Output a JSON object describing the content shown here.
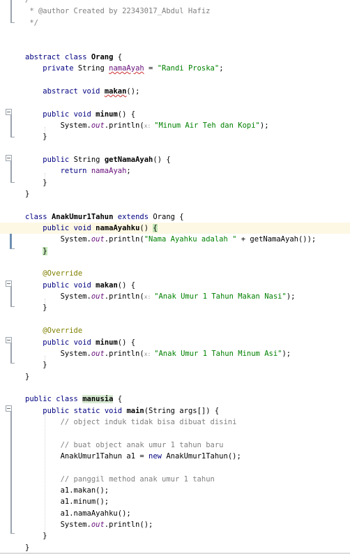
{
  "code_lines": [
    [
      {
        "t": "/**",
        "c": "cm"
      }
    ],
    [
      {
        "t": " * @author Created by 22343017_Abdul Hafiz",
        "c": "cm"
      }
    ],
    [
      {
        "t": " */",
        "c": "cm"
      }
    ],
    [],
    [],
    [
      {
        "t": "abstract ",
        "c": "kw"
      },
      {
        "t": "class ",
        "c": "kw"
      },
      {
        "t": "Orang",
        "c": "bold"
      },
      {
        "t": " {"
      }
    ],
    [
      {
        "t": "    "
      },
      {
        "t": "private ",
        "c": "kw"
      },
      {
        "t": "String "
      },
      {
        "t": "namaAyah",
        "c": "fld uw"
      },
      {
        "t": " = "
      },
      {
        "t": "\"Randi Proska\"",
        "c": "str"
      },
      {
        "t": ";"
      }
    ],
    [],
    [
      {
        "t": "    "
      },
      {
        "t": "abstract ",
        "c": "kw"
      },
      {
        "t": "void ",
        "c": "kw"
      },
      {
        "t": "makan",
        "c": "bold uw"
      },
      {
        "t": "();"
      }
    ],
    [],
    [
      {
        "t": "    "
      },
      {
        "t": "public ",
        "c": "kw"
      },
      {
        "t": "void ",
        "c": "kw"
      },
      {
        "t": "minum",
        "c": "bold"
      },
      {
        "t": "() {"
      }
    ],
    [
      {
        "t": "        System."
      },
      {
        "t": "out",
        "c": "out"
      },
      {
        "t": ".println("
      },
      {
        "t": "x: ",
        "c": "hint"
      },
      {
        "t": "\"Minum Air Teh dan Kopi\"",
        "c": "str"
      },
      {
        "t": ");"
      }
    ],
    [
      {
        "t": "    }"
      }
    ],
    [],
    [
      {
        "t": "    "
      },
      {
        "t": "public ",
        "c": "kw"
      },
      {
        "t": "String "
      },
      {
        "t": "getNamaAyah",
        "c": "bold"
      },
      {
        "t": "() {"
      }
    ],
    [
      {
        "t": "        "
      },
      {
        "t": "return ",
        "c": "kw"
      },
      {
        "t": "namaAyah",
        "c": "fld"
      },
      {
        "t": ";"
      }
    ],
    [
      {
        "t": "    }"
      }
    ],
    [
      {
        "t": "}"
      }
    ],
    [],
    [
      {
        "t": "class ",
        "c": "kw"
      },
      {
        "t": "AnakUmur1Tahun",
        "c": "bold"
      },
      {
        "t": " "
      },
      {
        "t": "extends ",
        "c": "kw"
      },
      {
        "t": "Orang"
      },
      {
        "t": " {"
      }
    ],
    [
      {
        "t": "    "
      },
      {
        "t": "public ",
        "c": "kw"
      },
      {
        "t": "void ",
        "c": "kw"
      },
      {
        "t": "namaAyahku",
        "c": "bold"
      },
      {
        "t": "() "
      },
      {
        "t": "{",
        "c": "hl-brace"
      }
    ],
    [
      {
        "t": "        System."
      },
      {
        "t": "out",
        "c": "out"
      },
      {
        "t": ".println("
      },
      {
        "t": "\"Nama Ayahku adalah \"",
        "c": "str"
      },
      {
        "t": " + getNamaAyah());"
      }
    ],
    [
      {
        "t": "    "
      },
      {
        "t": "}",
        "c": "hl-brace"
      }
    ],
    [],
    [
      {
        "t": "    "
      },
      {
        "t": "@Override",
        "c": "ann"
      }
    ],
    [
      {
        "t": "    "
      },
      {
        "t": "public ",
        "c": "kw"
      },
      {
        "t": "void ",
        "c": "kw"
      },
      {
        "t": "makan",
        "c": "bold"
      },
      {
        "t": "() {"
      }
    ],
    [
      {
        "t": "        System."
      },
      {
        "t": "out",
        "c": "out"
      },
      {
        "t": ".println("
      },
      {
        "t": "x: ",
        "c": "hint"
      },
      {
        "t": "\"Anak Umur 1 Tahun Makan Nasi\"",
        "c": "str"
      },
      {
        "t": ");"
      }
    ],
    [
      {
        "t": "    }"
      }
    ],
    [],
    [
      {
        "t": "    "
      },
      {
        "t": "@Override",
        "c": "ann"
      }
    ],
    [
      {
        "t": "    "
      },
      {
        "t": "public ",
        "c": "kw"
      },
      {
        "t": "void ",
        "c": "kw"
      },
      {
        "t": "minum",
        "c": "bold"
      },
      {
        "t": "() {"
      }
    ],
    [
      {
        "t": "        System."
      },
      {
        "t": "out",
        "c": "out"
      },
      {
        "t": ".println("
      },
      {
        "t": "x: ",
        "c": "hint"
      },
      {
        "t": "\"Anak Umur 1 Tahun Minum Asi\"",
        "c": "str"
      },
      {
        "t": ");"
      }
    ],
    [
      {
        "t": "    }"
      }
    ],
    [
      {
        "t": "}"
      }
    ],
    [],
    [
      {
        "t": "public ",
        "c": "kw"
      },
      {
        "t": "class ",
        "c": "kw"
      },
      {
        "t": "manusia",
        "c": "bold hl-class"
      },
      {
        "t": " {"
      }
    ],
    [
      {
        "t": "    "
      },
      {
        "t": "public ",
        "c": "kw"
      },
      {
        "t": "static ",
        "c": "kw"
      },
      {
        "t": "void ",
        "c": "kw"
      },
      {
        "t": "main",
        "c": "bold"
      },
      {
        "t": "(String args[]) {"
      }
    ],
    [
      {
        "t": "        "
      },
      {
        "t": "// object induk tidak bisa dibuat disini",
        "c": "cm"
      }
    ],
    [],
    [
      {
        "t": "        "
      },
      {
        "t": "// buat object anak umur 1 tahun baru",
        "c": "cm"
      }
    ],
    [
      {
        "t": "        AnakUmur1Tahun a1 = "
      },
      {
        "t": "new ",
        "c": "kw"
      },
      {
        "t": "AnakUmur1Tahun();"
      }
    ],
    [],
    [
      {
        "t": "        "
      },
      {
        "t": "// panggil method anak umur 1 tahun",
        "c": "cm"
      }
    ],
    [
      {
        "t": "        a1.makan();"
      }
    ],
    [
      {
        "t": "        a1.minum();"
      }
    ],
    [
      {
        "t": "        a1.namaAyahku();"
      }
    ],
    [
      {
        "t": "        System."
      },
      {
        "t": "out",
        "c": "out"
      },
      {
        "t": ".println();"
      }
    ],
    [
      {
        "t": "    }"
      }
    ],
    [
      {
        "t": "}"
      }
    ]
  ],
  "current_line": 20
}
